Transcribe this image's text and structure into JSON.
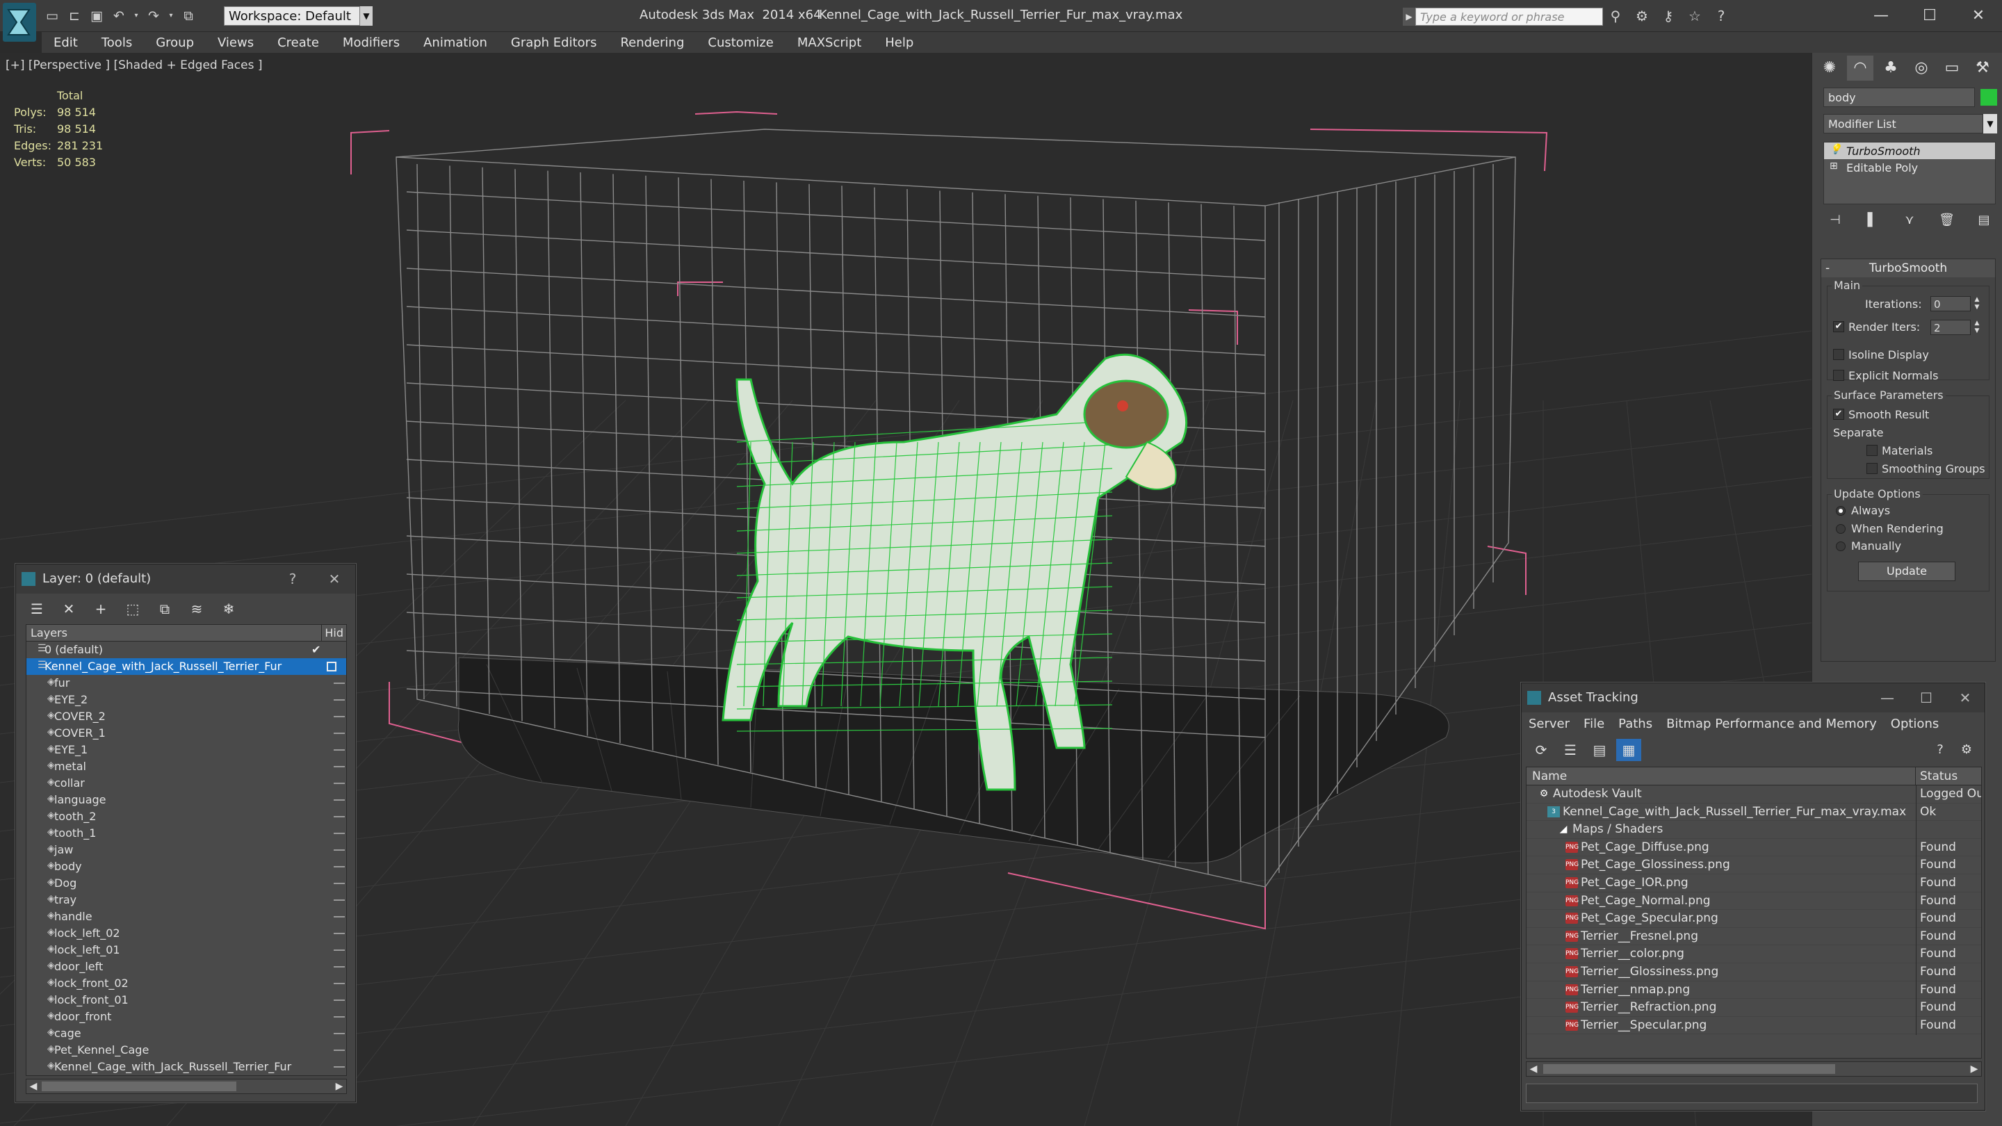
{
  "titlebar": {
    "workspace": "Workspace: Default",
    "app_title": "Autodesk 3ds Max  2014 x64",
    "doc_title": "Kennel_Cage_with_Jack_Russell_Terrier_Fur_max_vray.max",
    "search_placeholder": "Type a keyword or phrase",
    "minimize": "—",
    "maximize": "☐",
    "close": "✕"
  },
  "menu": [
    "Edit",
    "Tools",
    "Group",
    "Views",
    "Create",
    "Modifiers",
    "Animation",
    "Graph Editors",
    "Rendering",
    "Customize",
    "MAXScript",
    "Help"
  ],
  "viewport": {
    "label": "[+] [Perspective ] [Shaded + Edged Faces ]",
    "stats": {
      "header": "Total",
      "rows": [
        {
          "k": "Polys:",
          "v": "98 514"
        },
        {
          "k": "Tris:",
          "v": "98 514"
        },
        {
          "k": "Edges:",
          "v": "281 231"
        },
        {
          "k": "Verts:",
          "v": "50 583"
        }
      ]
    }
  },
  "command_panel": {
    "object_name": "body",
    "object_color": "#28c43c",
    "modifier_list": "Modifier List",
    "stack": [
      {
        "label": "TurboSmooth",
        "selected": true
      },
      {
        "label": "Editable Poly",
        "selected": false
      }
    ],
    "rollout_title": "TurboSmooth",
    "main_group": "Main",
    "iterations_label": "Iterations:",
    "iterations_value": "0",
    "render_iters_label": "Render Iters:",
    "render_iters_value": "2",
    "render_iters_checked": "✔",
    "isoline_label": "Isoline Display",
    "explicit_normals_label": "Explicit Normals",
    "surface_group": "Surface Parameters",
    "smooth_result_label": "Smooth Result",
    "smooth_result_checked": "✔",
    "separate_label": "Separate",
    "materials_label": "Materials",
    "smoothing_groups_label": "Smoothing Groups",
    "update_group": "Update Options",
    "always_label": "Always",
    "when_rendering_label": "When Rendering",
    "manually_label": "Manually",
    "update_button": "Update"
  },
  "layer_window": {
    "title": "Layer: 0 (default)",
    "help": "?",
    "close": "✕",
    "col_layers": "Layers",
    "col_hide": "Hid",
    "rows": [
      {
        "name": "0 (default)",
        "indent": 0,
        "selected": false,
        "check": true
      },
      {
        "name": "Kennel_Cage_with_Jack_Russell_Terrier_Fur",
        "indent": 0,
        "selected": true,
        "box": true
      },
      {
        "name": "fur",
        "indent": 1
      },
      {
        "name": "EYE_2",
        "indent": 1
      },
      {
        "name": "COVER_2",
        "indent": 1
      },
      {
        "name": "COVER_1",
        "indent": 1
      },
      {
        "name": "EYE_1",
        "indent": 1
      },
      {
        "name": "metal",
        "indent": 1
      },
      {
        "name": "collar",
        "indent": 1
      },
      {
        "name": "language",
        "indent": 1
      },
      {
        "name": "tooth_2",
        "indent": 1
      },
      {
        "name": "tooth_1",
        "indent": 1
      },
      {
        "name": "jaw",
        "indent": 1
      },
      {
        "name": "body",
        "indent": 1
      },
      {
        "name": "Dog",
        "indent": 1
      },
      {
        "name": "tray",
        "indent": 1
      },
      {
        "name": "handle",
        "indent": 1
      },
      {
        "name": "lock_left_02",
        "indent": 1
      },
      {
        "name": "lock_left_01",
        "indent": 1
      },
      {
        "name": "door_left",
        "indent": 1
      },
      {
        "name": "lock_front_02",
        "indent": 1
      },
      {
        "name": "lock_front_01",
        "indent": 1
      },
      {
        "name": "door_front",
        "indent": 1
      },
      {
        "name": "cage",
        "indent": 1
      },
      {
        "name": "Pet_Kennel_Cage",
        "indent": 1
      },
      {
        "name": "Kennel_Cage_with_Jack_Russell_Terrier_Fur",
        "indent": 1
      }
    ]
  },
  "asset_window": {
    "title": "Asset Tracking",
    "menu": [
      "Server",
      "File",
      "Paths",
      "Bitmap Performance and Memory",
      "Options"
    ],
    "col_name": "Name",
    "col_status": "Status",
    "rows": [
      {
        "name": "Autodesk Vault",
        "status": "Logged Ou",
        "indent": 0,
        "type": "vault"
      },
      {
        "name": "Kennel_Cage_with_Jack_Russell_Terrier_Fur_max_vray.max",
        "status": "Ok",
        "indent": 1,
        "type": "max"
      },
      {
        "name": "Maps / Shaders",
        "status": "",
        "indent": 2,
        "type": "maps"
      },
      {
        "name": "Pet_Cage_Diffuse.png",
        "status": "Found",
        "indent": 3,
        "type": "png"
      },
      {
        "name": "Pet_Cage_Glossiness.png",
        "status": "Found",
        "indent": 3,
        "type": "png"
      },
      {
        "name": "Pet_Cage_IOR.png",
        "status": "Found",
        "indent": 3,
        "type": "png"
      },
      {
        "name": "Pet_Cage_Normal.png",
        "status": "Found",
        "indent": 3,
        "type": "png"
      },
      {
        "name": "Pet_Cage_Specular.png",
        "status": "Found",
        "indent": 3,
        "type": "png"
      },
      {
        "name": "Terrier__Fresnel.png",
        "status": "Found",
        "indent": 3,
        "type": "png"
      },
      {
        "name": "Terrier__color.png",
        "status": "Found",
        "indent": 3,
        "type": "png"
      },
      {
        "name": "Terrier__Glossiness.png",
        "status": "Found",
        "indent": 3,
        "type": "png"
      },
      {
        "name": "Terrier__nmap.png",
        "status": "Found",
        "indent": 3,
        "type": "png"
      },
      {
        "name": "Terrier__Refraction.png",
        "status": "Found",
        "indent": 3,
        "type": "png"
      },
      {
        "name": "Terrier__Specular.png",
        "status": "Found",
        "indent": 3,
        "type": "png"
      }
    ]
  }
}
